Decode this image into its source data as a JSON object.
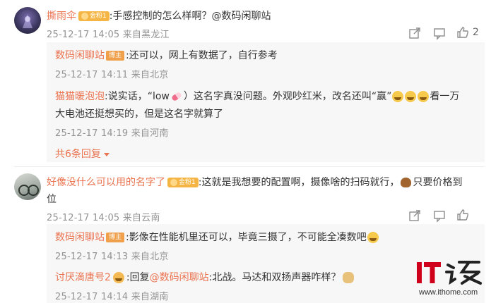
{
  "comments": [
    {
      "username": "撕雨伞",
      "badge": "金粉1",
      "text": ":手感控制的怎么样啊？@数码闲聊站",
      "meta": "25-12-17 14:05 来自黑龙江",
      "like_count": "2",
      "replies": [
        {
          "username": "数码闲聊站",
          "owner_badge": "博主",
          "text": ":还可以，网上有数据了，自行参考",
          "meta": "25-12-17 14:11 来自北京"
        },
        {
          "username": "猫猫暖泡泡",
          "text_a": ":说实话，“low",
          "text_b": "）这名字真没问题。外观吵红米，改名还叫“赢”",
          "text_c": "看一万",
          "text_line2": "大电池还挺想买的，但是这名字就算了",
          "meta": "25-12-17 14:19 来自河南"
        }
      ],
      "more_replies": "共6条回复"
    },
    {
      "username": "好像没什么可以用的名字了",
      "badge": "金粉1",
      "text_line1": ":这就是我想要的配置啊，摄像啥的扫码就行，",
      "text_line1b": "只要价格到",
      "text_line2": "位",
      "meta": "25-12-17 14:05 来自云南",
      "replies": [
        {
          "username": "数码闲聊站",
          "owner_badge": "博主",
          "text": ":影像在性能机里还可以，毕竟三摄了，不可能全凑数吧",
          "meta": "25-12-17 14:13 来自北京"
        },
        {
          "username": "讨厌滴唐号2",
          "prefix": ":回复",
          "mention": "@数码闲聊站",
          "text": ":北战。马达和双扬声器咋样？",
          "meta": "25-12-17 14:14 来自湖南"
        }
      ]
    }
  ],
  "watermark": {
    "brand": "IT之家",
    "site": "www.ithome.com"
  }
}
